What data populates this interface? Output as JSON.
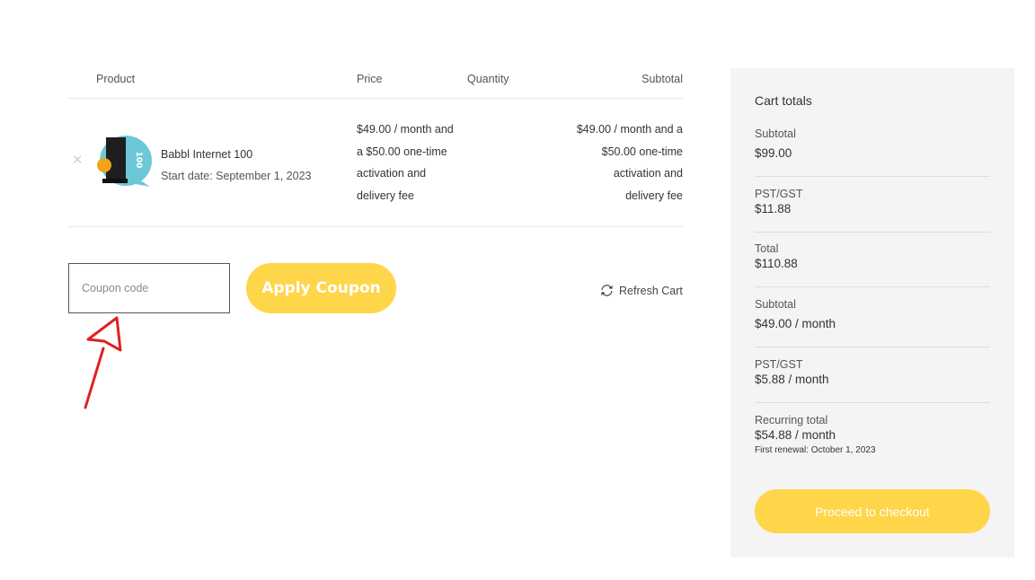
{
  "table": {
    "headers": {
      "product": "Product",
      "price": "Price",
      "quantity": "Quantity",
      "subtotal": "Subtotal"
    },
    "item": {
      "name": "Babbl Internet 100",
      "start_date": "Start date: September 1, 2023",
      "price_lines": [
        "$49.00 / month and",
        "a $50.00 one-time",
        "activation and",
        "delivery fee"
      ],
      "subtotal_lines": [
        "$49.00 / month and a",
        "$50.00 one-time",
        "activation and",
        "delivery fee"
      ],
      "thumb_badge": "100",
      "remove_icon": "close-icon"
    }
  },
  "coupon": {
    "placeholder": "Coupon code",
    "apply_label": "Apply Coupon"
  },
  "refresh": {
    "label": "Refresh Cart",
    "icon": "refresh-icon"
  },
  "totals": {
    "title": "Cart totals",
    "rows": [
      {
        "label": "Subtotal",
        "value": "$99.00"
      },
      {
        "label": "PST/GST",
        "value": "$11.88"
      },
      {
        "label": "Total",
        "value": "$110.88"
      },
      {
        "label": "Subtotal",
        "value": "$49.00 / month"
      },
      {
        "label": "PST/GST",
        "value": "$5.88 / month"
      },
      {
        "label": "Recurring total",
        "value": "$54.88 / month",
        "note": "First renewal: October 1, 2023"
      }
    ],
    "checkout_label": "Proceed to checkout"
  },
  "colors": {
    "accent": "#ffd54a",
    "panel": "#f4f4f4",
    "annotation": "#e02020"
  }
}
